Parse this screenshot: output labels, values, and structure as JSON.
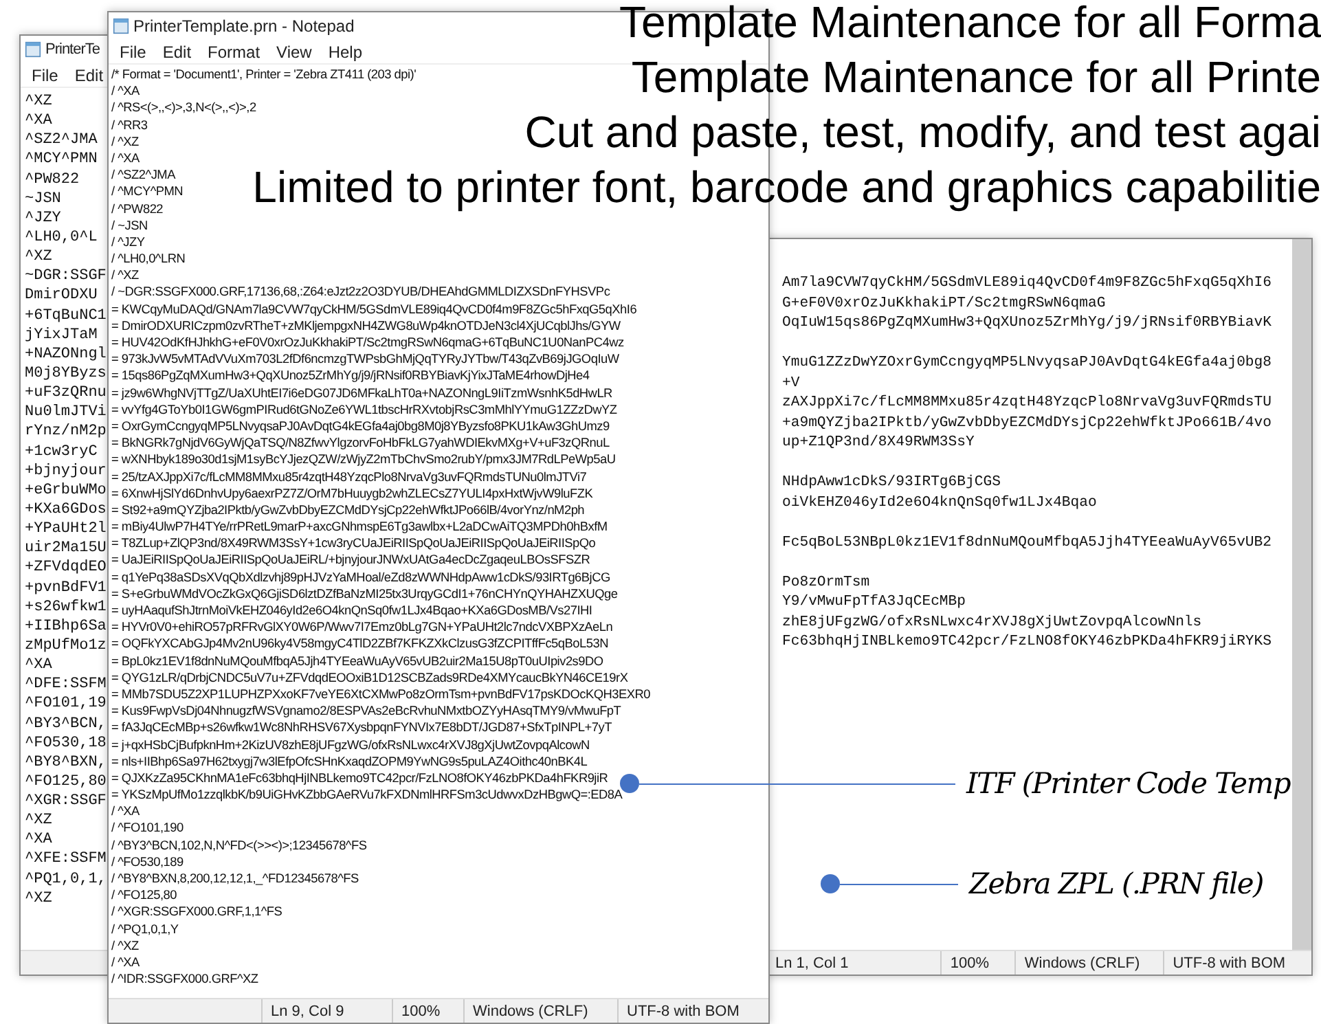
{
  "headings": [
    "Template Maintenance for all Forma",
    "Template Maintenance for all Printe",
    "Cut and paste, test, modify, and test agai",
    "Limited to printer font, barcode and graphics capabilitie"
  ],
  "back_window_left": {
    "title": "PrinterTe",
    "menu": [
      "File",
      "Edit"
    ],
    "lines": [
      "^XZ",
      "^XA",
      "^SZ2^JMA",
      "^MCY^PMN",
      "^PW822",
      "~JSN",
      "^JZY",
      "^LH0,0^L",
      "^XZ",
      "~DGR:SSGF",
      "DmirODXU",
      "+6TqBuNC1",
      "jYixJTaM",
      "+NAZONngl",
      "M0j8YByzs",
      "+uF3zQRnu",
      "Nu0lmJTVi",
      "rYnz/nM2p",
      "+1cw3ryC",
      "+bjnyjour",
      "+eGrbuWMo",
      "+KXa6GDos",
      "+YPaUHt2l",
      "uir2Ma15U",
      "+ZFVdqdEO",
      "+pvnBdFV1",
      "+s26wfkw1",
      "+IIBhp6Sa",
      "zMpUfMo1z",
      "^XA",
      "^DFE:SSFM",
      "^FO101,19",
      "^BY3^BCN,",
      "^FO530,18",
      "^BY8^BXN,",
      "^FO125,80",
      "^XGR:SSGF",
      "^XZ",
      "^XA",
      "^XFE:SSFM",
      "^PQ1,0,1,",
      "^XZ"
    ]
  },
  "front_window": {
    "title": "PrinterTemplate.prn - Notepad",
    "menu": [
      "File",
      "Edit",
      "Format",
      "View",
      "Help"
    ],
    "lines": [
      "/* Format = 'Document1', Printer = 'Zebra ZT411 (203 dpi)'",
      "/ ^XA",
      "/ ^RS<(>,,<)>,3,N<(>,,<)>,2",
      "/ ^RR3",
      "/ ^XZ",
      "/ ^XA",
      "/ ^SZ2^JMA",
      "/ ^MCY^PMN",
      "/ ^PW822",
      "/ ~JSN",
      "/ ^JZY",
      "/ ^LH0,0^LRN",
      "/ ^XZ",
      "/ ~DGR:SSGFX000.GRF,17136,68,:Z64:eJzt2z2O3DYUB/DHEAhdGMMLDIZXSDnFYHSVPc",
      "= KWCqyMuDAQd/GNAm7la9CVW7qyCkHM/5GSdmVLE89iq4QvCD0f4m9F8ZGc5hFxqG5qXhI6",
      "= DmirODXURICzpm0zvRTheT+zMKljempgxNH4ZWG8uWp4knOTDJeN3cl4XjUCqblJhs/GYW",
      "= HUV42OdKfHJhkhG+eF0V0xrOzJuKkhakiPT/Sc2tmgRSwN6qmaG+6TqBuNC1U0NanPC4wz",
      "= 973kJvW5vMTAdVVuXm703L2fDf6ncmzgTWPsbGhMjQqTYRyJYTbw/T43qZvB69jJGOqIuW",
      "= 15qs86PgZqMXumHw3+QqXUnoz5ZrMhYg/j9/jRNsif0RBYBiavKjYixJTaME4rhowDjHe4",
      "= jz9w6WhgNVjTTgZ/UaXUhtEI7i6eDG07JD6MFkaLhT0a+NAZONngL9IiTzmWsnhK5dHwLR",
      "= vvYfg4GToYb0I1GW6gmPIRud6tGNoZe6YWL1tbscHrRXvtobjRsC3mMhlYYmuG1ZZzDwYZ",
      "= OxrGymCcngyqMP5LNvyqsaPJ0AvDqtG4kEGfa4aj0bg8M0j8YByzsfo8PKU1kAw3GhUmz9",
      "= BkNGRk7gNjdV6GyWjQaTSQ/N8ZfwvYlgzorvFoHbFkLG7yahWDIEkvMXg+V+uF3zQRnuL",
      "= wXNHbyk189o30d1sjM1syBcYJjezQZW/zWjyZ2mTbChvSmo2rubY/pmx3JM7RdLPeWp5aU",
      "= 25/tzAXJppXi7c/fLcMM8MMxu85r4zqtH48YzqcPlo8NrvaVg3uvFQRmdsTUNu0lmJTVi7",
      "= 6XnwHjSlYd6DnhvUpy6aexrPZ7Z/OrM7bHuuygb2whZLECsZ7YULI4pxHxtWjvW9luFZK",
      "= St92+a9mQYZjba2IPktb/yGwZvbDbyEZCMdDYsjCp22ehWfktJPo66lB/4vorYnz/nM2ph",
      "= mBiy4UlwP7H4TYe/rrPRetL9marP+axcGNhmspE6Tg3awlbx+L2aDCwAiTQ3MPDh0hBxfM",
      "= T8ZLup+ZlQP3nd/8X49RWM3SsY+1cw3ryCUaJEiRIISpQoUaJEiRIISpQoUaJEiRIISpQo",
      "= UaJEiRIISpQoUaJEiRIISpQoUaJEiRL/+bjnyjourJNWxUAtGa4ecDcZgaqeuLBOsSFSZR",
      "= q1YePq38aSDsXVqQbXdlzvhj89pHJVzYaMHoal/eZd8zWWNHdpAww1cDkS/93IRTg6BjCG",
      "= S+eGrbuWMdVOcZkGxQ6GjiSD6lztDZfBaNzMI25tx3UrqyGCdI1+76nCHYnQYHAHZXUQge",
      "= uyHAaqufShJtrnMoiVkEHZ046yId2e6O4knQnSq0fw1LJx4Bqao+KXa6GDosMB/Vs27IHI",
      "= HYVr0V0+ehiRO57pRFRvGlXY0W6P/Wwv7I7Emz0bLg7GN+YPaUHt2lc7ndcVXBPXzAeLn",
      "= OQFkYXCAbGJp4Mv2nU96ky4V58mgyC4TlD2ZBf7KFKZXkClzusG3fZCPITffFc5qBoL53N",
      "= BpL0kz1EV1f8dnNuMQouMfbqA5Jjh4TYEeaWuAyV65vUB2uir2Ma15U8pT0uUIpiv2s9DO",
      "= QYG1zLR/qDrbjCNDC5uV7u+ZFVdqdEOOxiB1D12SCBZads9RDe4XMYcaucBkYN46CE19rX",
      "= MMb7SDU5Z2XP1LUPHZPXxoKF7veYE6XtCXMwPo8zOrmTsm+pvnBdFV17psKDOcKQH3EXR0",
      "= Kus9FwpVsDj04NhnugzfWSVgnamo2/8ESPVAs2eBcRvhuNMxtbOZYyHAsqTMY9/vMwuFpT",
      "= fA3JqCEcMBp+s26wfkw1Wc8NhRHSV67XysbpqnFYNVIx7E8bDT/JGD87+SfxTpINPL+7yT",
      "= j+qxHSbCjBufpknHm+2KizUV8zhE8jUFgzWG/ofxRsNLwxc4rXVJ8gXjUwtZovpqAlcowN",
      "= nls+IIBhp6Sa97H62txygj7w3lEfpOfcSHnKxaqdZOPM9YwNG9s5puLAZ4Oithc40nBK4L",
      "= QJXKzZa95CKhnMA1eFc63bhqHjINBLkemo9TC42pcr/FzLNO8fOKY46zbPKDa4hFKR9jiR",
      "= YKSzMpUfMo1zzqlkbK/b9UiGHvKZbbGAeRVu7kFXDNmlHRFSm3cUdwvxDzHBgwQ=:ED8A",
      "/ ^XA",
      "/ ^FO101,190",
      "/ ^BY3^BCN,102,N,N^FD<(>><)>;12345678^FS",
      "/ ^FO530,189",
      "/ ^BY8^BXN,8,200,12,12,1,_^FD12345678^FS",
      "/ ^FO125,80",
      "/ ^XGR:SSGFX000.GRF,1,1^FS",
      "/ ^PQ1,0,1,Y",
      "/ ^XZ",
      "/ ^XA",
      "/ ^IDR:SSGFX000.GRF^XZ"
    ],
    "status_bar": [
      "Ln 9, Col 9",
      "100%",
      "Windows (CRLF)",
      "UTF-8 with BOM"
    ]
  },
  "back_window_right": {
    "line_groups": [
      [
        "Am7la9CVW7qyCkHM/5GSdmVLE89iq4QvCD0f4m9F8ZGc5hFxqG5qXhI6",
        "G+eF0V0xrOzJuKkhakiPT/Sc2tmgRSwN6qmaG",
        "OqIuW15qs86PgZqMXumHw3+QqXUnoz5ZrMhYg/j9/jRNsif0RBYBiavK"
      ],
      [
        "YmuG1ZZzDwYZOxrGymCcngyqMP5LNvyqsaPJ0AvDqtG4kEGfa4aj0bg8",
        "+V",
        "zAXJppXi7c/fLcMM8MMxu85r4zqtH48YzqcPlo8NrvaVg3uvFQRmdsTU",
        "+a9mQYZjba2IPktb/yGwZvbDbyEZCMdDYsjCp22ehWfktJPo661B/4vo",
        "up+Z1QP3nd/8X49RWM3SsY"
      ],
      [
        "NHdpAww1cDkS/93IRTg6BjCGS",
        "oiVkEHZ046yId2e6O4knQnSq0fw1LJx4Bqao"
      ],
      [
        "Fc5qBoL53NBpL0kz1EV1f8dnNuMQouMfbqA5Jjh4TYEeaWuAyV65vUB2"
      ],
      [
        "Po8zOrmTsm",
        "Y9/vMwuFpTfA3JqCEcMBp",
        "zhE8jUFgzWG/ofxRsNLwxc4rXVJ8gXjUwtZovpqAlcowNnls",
        "Fc63bhqHjINBLkemo9TC42pcr/FzLNO8fOKY46zbPKDa4hFKR9jiRYKS"
      ]
    ],
    "status_bar": [
      "Ln 1, Col 1",
      "100%",
      "Windows (CRLF)",
      "UTF-8 with BOM"
    ]
  },
  "callouts": [
    {
      "label": "ITF (Printer Code Temp"
    },
    {
      "label": "Zebra ZPL (.PRN file)"
    }
  ]
}
